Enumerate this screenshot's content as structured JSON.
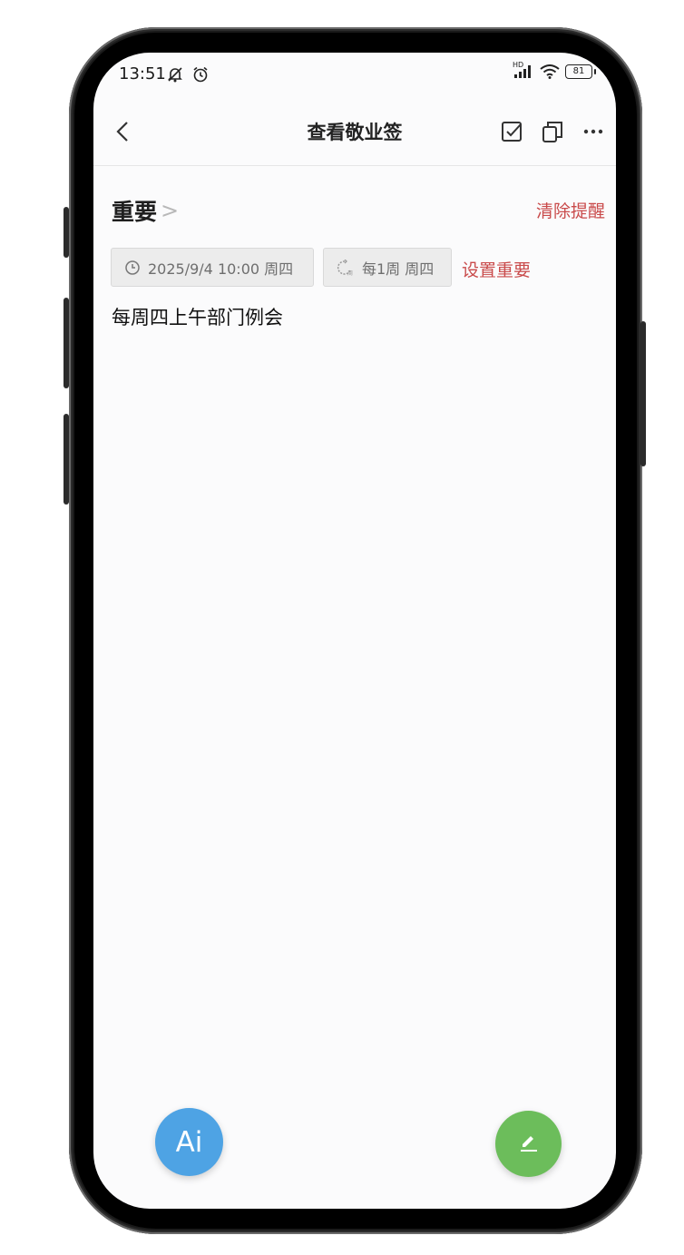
{
  "status_bar": {
    "time": "13:51",
    "network_label": "HD",
    "battery_level": "81"
  },
  "top_bar": {
    "title": "查看敬业签"
  },
  "note": {
    "category": "重要",
    "clear_reminder_label": "清除提醒",
    "reminder_time": "2025/9/4 10:00 周四",
    "repeat_rule": "每1周 周四",
    "set_important_label": "设置重要",
    "content": "每周四上午部门例会"
  },
  "fab": {
    "ai_label": "Ai"
  },
  "colors": {
    "accent_red": "#c94a4a",
    "ai_blue": "#4ea3e4",
    "edit_green": "#6cbd5b",
    "chip_bg": "#ececec"
  },
  "icons": [
    "mute-icon",
    "alarm-icon",
    "signal-icon",
    "wifi-icon",
    "battery-icon",
    "back-icon",
    "checkbox-icon",
    "copy-icon",
    "more-icon",
    "clock-icon",
    "repeat-icon",
    "edit-icon"
  ]
}
